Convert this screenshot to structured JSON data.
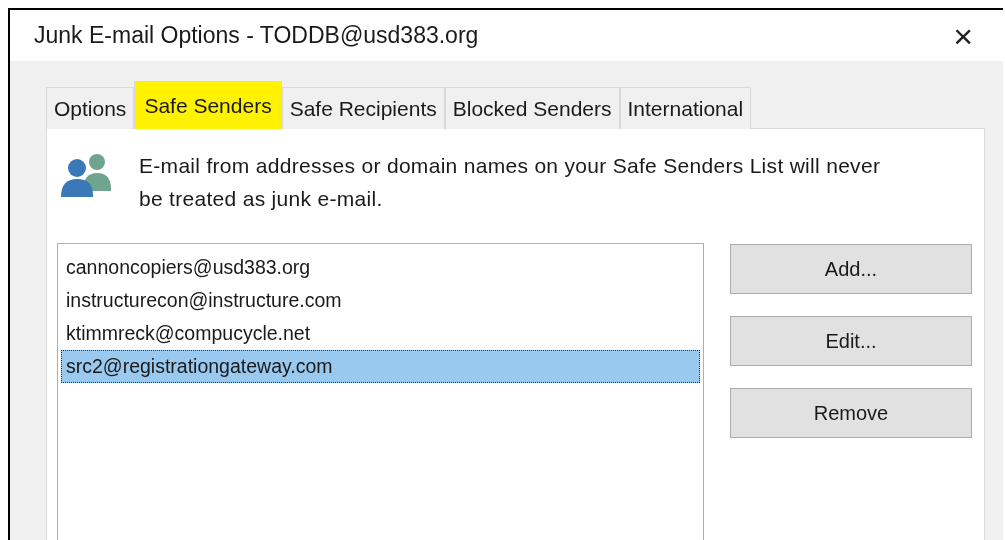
{
  "window": {
    "title": "Junk E-mail Options - TODDB@usd383.org",
    "close": "×"
  },
  "tabs": [
    {
      "label": "Options",
      "selected": false,
      "highlighted": false
    },
    {
      "label": "Safe Senders",
      "selected": true,
      "highlighted": true
    },
    {
      "label": "Safe Recipients",
      "selected": false,
      "highlighted": false
    },
    {
      "label": "Blocked Senders",
      "selected": false,
      "highlighted": false
    },
    {
      "label": "International",
      "selected": false,
      "highlighted": false
    }
  ],
  "description": "E-mail from addresses or domain names on your Safe Senders List will never be treated as junk e-mail.",
  "senders": [
    {
      "address": "cannoncopiers@usd383.org",
      "selected": false
    },
    {
      "address": "instructurecon@instructure.com",
      "selected": false
    },
    {
      "address": "ktimmreck@compucycle.net",
      "selected": false
    },
    {
      "address": "src2@registrationgateway.com",
      "selected": true
    }
  ],
  "buttons": [
    "Add...",
    "Edit...",
    "Remove"
  ]
}
